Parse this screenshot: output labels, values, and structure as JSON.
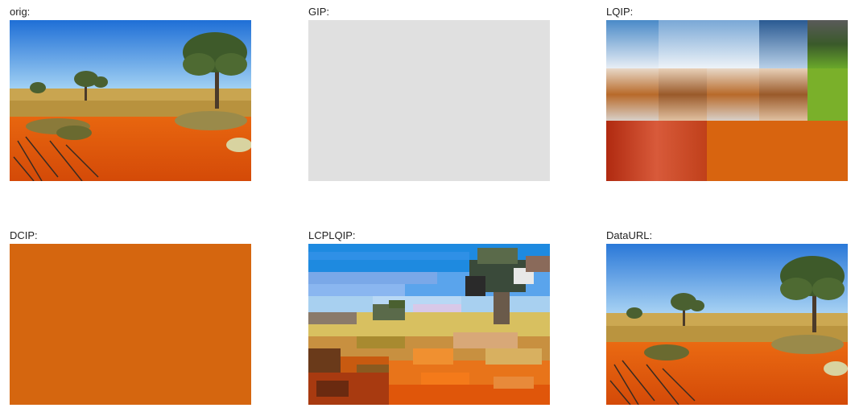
{
  "panels": [
    {
      "label": "orig:"
    },
    {
      "label": "GIP:"
    },
    {
      "label": "LQIP:"
    },
    {
      "label": "DCIP:"
    },
    {
      "label": "LCPLQIP:"
    },
    {
      "label": "DataURL:"
    }
  ],
  "colors": {
    "gip_fill": "#e0e0e0",
    "dcip_fill": "#d5660f",
    "sky": "#2f7fd8",
    "sand": "#e2580f",
    "grass": "#c9a550"
  }
}
